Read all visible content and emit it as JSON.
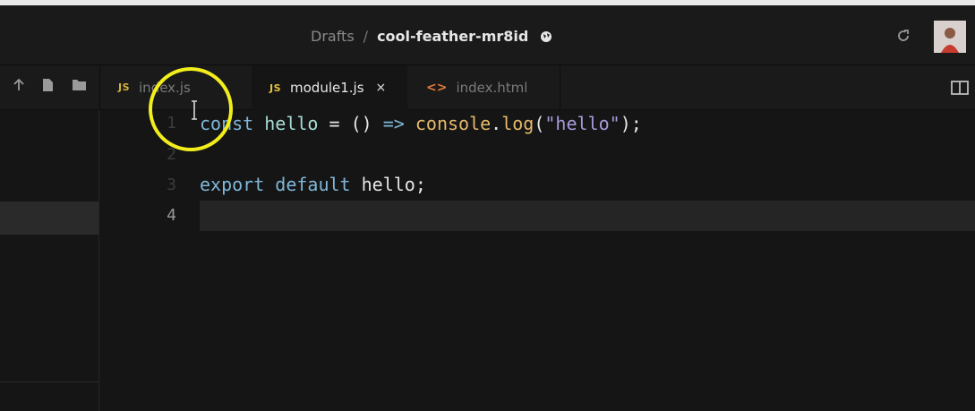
{
  "header": {
    "breadcrumb_root": "Drafts",
    "breadcrumb_sep": "/",
    "sandbox_name": "cool-feather-mr8id"
  },
  "tabs": [
    {
      "badge": "JS",
      "label": "index.js"
    },
    {
      "badge": "JS",
      "label": "module1.js",
      "close": "×"
    },
    {
      "badge": "<>",
      "label": "index.html"
    }
  ],
  "editor": {
    "line_numbers": [
      "1",
      "2",
      "3",
      "4"
    ],
    "lines": {
      "l1": {
        "t1": "const",
        "t2": " ",
        "t3": "hello",
        "t4": " = () ",
        "t5": "=>",
        "t6": " ",
        "t7": "console",
        "t8": ".",
        "t9": "log",
        "t10": "(",
        "t11": "\"hello\"",
        "t12": ");"
      },
      "l3": {
        "t1": "export",
        "t2": " ",
        "t3": "default",
        "t4": " hello;"
      }
    }
  },
  "colors": {
    "accent_yellow": "#f2ee1c",
    "js_badge": "#e2c140",
    "html_badge": "#e07b39",
    "keyword": "#7fb7d8",
    "string": "#a89ad8"
  }
}
